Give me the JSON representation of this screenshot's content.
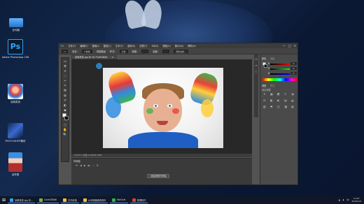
{
  "desktop": {
    "icons": [
      {
        "label": "此电脑",
        "icon": "computer-icon"
      },
      {
        "label": "Adobe Photoshop CS6",
        "icon": "photoshop-icon"
      },
      {
        "label": "涂鸦男孩",
        "icon": "image-thumbnail-icon"
      },
      {
        "label": "PHOTOSHOP素材",
        "icon": "folder-thumbnail-icon"
      },
      {
        "label": "证件照",
        "icon": "portrait-thumbnail-icon"
      }
    ]
  },
  "photoshop": {
    "menu": [
      "Ps",
      "文件(F)",
      "编辑(E)",
      "图像(I)",
      "图层(L)",
      "文字(Y)",
      "选择(S)",
      "滤镜(T)",
      "3D(D)",
      "视图(V)",
      "窗口(W)",
      "帮助(H)"
    ],
    "window_controls": [
      "—",
      "□",
      "✕"
    ],
    "options": {
      "feather_label": "羽化:",
      "feather_value": "0 像素",
      "antialias_label": "消除锯齿",
      "style_label": "样式:",
      "style_value": "正常",
      "width_label": "宽度:",
      "height_label": "高度:",
      "refine_button": "调整边缘..."
    },
    "document_tab": "涂鸦男孩.jpg @ 16.7%(RGB/8)",
    "document_close": "×",
    "status_bar": "16.67%   文档:2.32M/2.32M",
    "timeline": {
      "tab": "时间轴",
      "create_button": "创建视频时间轴"
    },
    "tools": [
      "▭",
      "✥",
      "⌖",
      "◌",
      "✂",
      "✎",
      "⌘",
      "◍",
      "✐",
      "◐",
      "◆",
      "T",
      "↖",
      "▢",
      "✋",
      "🔍"
    ],
    "panel": {
      "color_tab": "颜色",
      "swatches_tab": "色板",
      "adjustments_tab": "调整",
      "styles_tab": "样式",
      "add_adjustment": "添加调整",
      "sliders": [
        {
          "label": "R",
          "value": "0"
        },
        {
          "label": "G",
          "value": "0"
        },
        {
          "label": "B",
          "value": "0"
        }
      ],
      "adjustment_icons": [
        "☀",
        "▦",
        "◩",
        "▽",
        "◑",
        "⚖",
        "◧",
        "◐",
        "▤",
        "◒",
        "▥",
        "◓",
        "◫",
        "◨",
        "▧"
      ]
    },
    "colors": {
      "foreground": "#ffffff",
      "background": "#000000"
    }
  },
  "taskbar": {
    "start_icon": "windows-start-icon",
    "tasks": [
      {
        "label": "涂鸦男孩.jpg @...",
        "color": "#2fa3f7"
      },
      {
        "label": "CorelDRAW",
        "color": "#7cb342"
      },
      {
        "label": "文件资源",
        "color": "#f0c040"
      },
      {
        "label": "公司电脑维修资料",
        "color": "#f0c040"
      },
      {
        "label": "WeChat",
        "color": "#2db34a"
      },
      {
        "label": "录屏软件",
        "color": "#d04040"
      }
    ],
    "clock_time": "14:07",
    "clock_date": "2019/1/9"
  }
}
